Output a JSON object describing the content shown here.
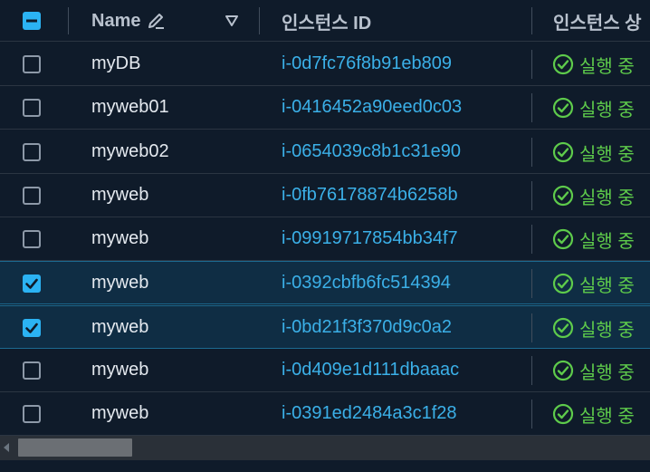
{
  "header": {
    "name_label": "Name",
    "instance_id_label": "인스턴스 ID",
    "instance_state_label": "인스턴스 상"
  },
  "rows": [
    {
      "name": "myDB",
      "instance_id": "i-0d7fc76f8b91eb809",
      "state": "실행 중",
      "selected": false
    },
    {
      "name": "myweb01",
      "instance_id": "i-0416452a90eed0c03",
      "state": "실행 중",
      "selected": false
    },
    {
      "name": "myweb02",
      "instance_id": "i-0654039c8b1c31e90",
      "state": "실행 중",
      "selected": false
    },
    {
      "name": "myweb",
      "instance_id": "i-0fb76178874b6258b",
      "state": "실행 중",
      "selected": false
    },
    {
      "name": "myweb",
      "instance_id": "i-09919717854bb34f7",
      "state": "실행 중",
      "selected": false
    },
    {
      "name": "myweb",
      "instance_id": "i-0392cbfb6fc514394",
      "state": "실행 중",
      "selected": true
    },
    {
      "name": "myweb",
      "instance_id": "i-0bd21f3f370d9c0a2",
      "state": "실행 중",
      "selected": true
    },
    {
      "name": "myweb",
      "instance_id": "i-0d409e1d111dbaaac",
      "state": "실행 중",
      "selected": false
    },
    {
      "name": "myweb",
      "instance_id": "i-0391ed2484a3c1f28",
      "state": "실행 중",
      "selected": false
    }
  ],
  "icons": {
    "select_all": "minus-checkbox-icon",
    "edit": "pencil-icon",
    "sort": "triangle-down-icon",
    "running": "check-circle-icon"
  },
  "colors": {
    "accent": "#2bb3f3",
    "link": "#3bb0e8",
    "running": "#5ecb4b",
    "background": "#0f1b2a",
    "selected_row": "#0f2d44"
  }
}
